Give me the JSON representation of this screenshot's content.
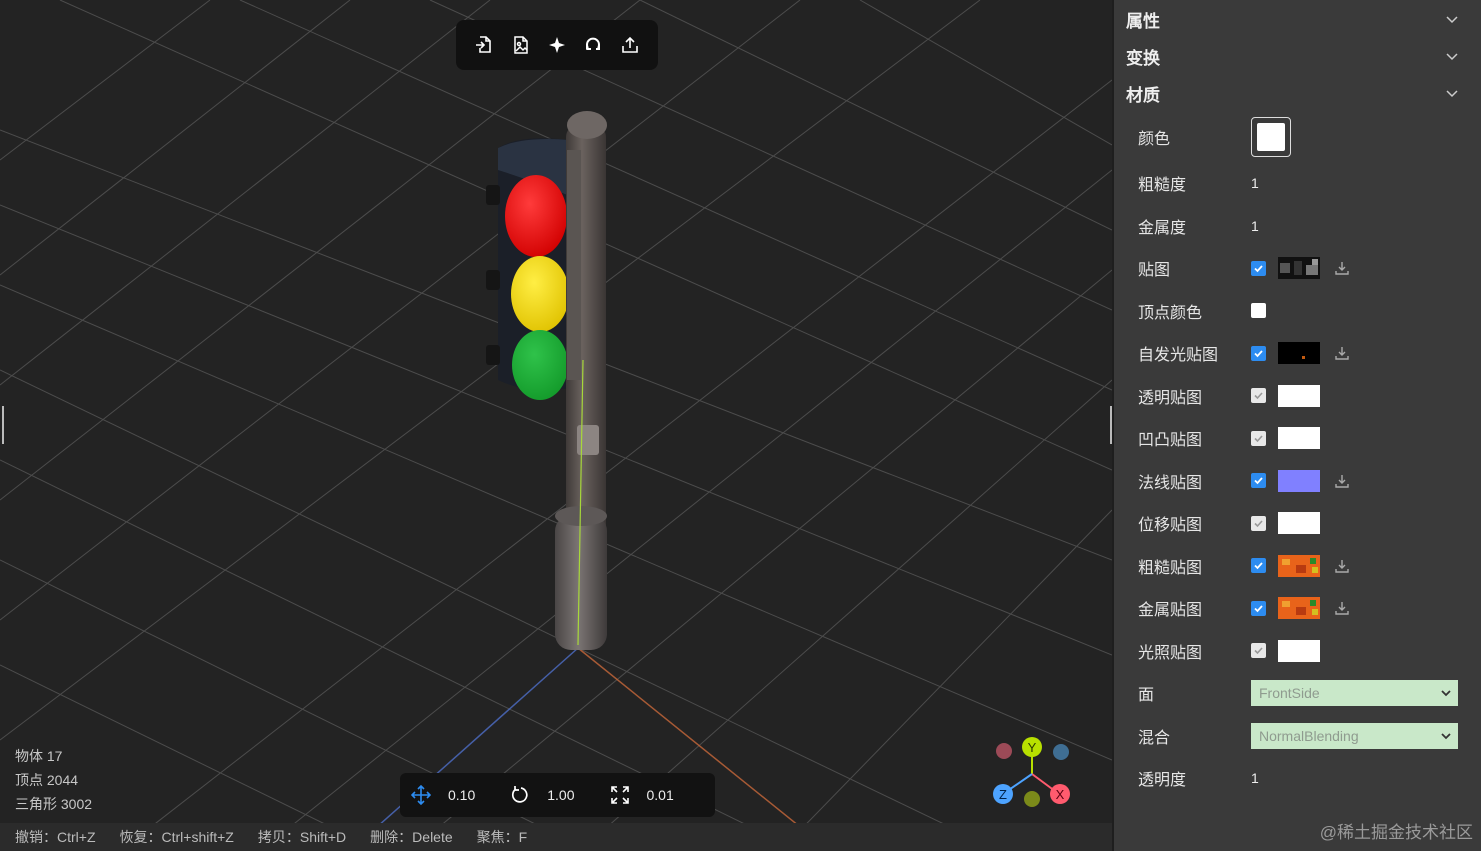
{
  "toolbar": {
    "buttons": [
      {
        "icon": "import-icon"
      },
      {
        "icon": "image-icon"
      },
      {
        "icon": "light-icon"
      },
      {
        "icon": "rotate-reset-icon"
      },
      {
        "icon": "export-icon"
      }
    ]
  },
  "stats": {
    "objects": "物体 17",
    "vertices": "顶点 2044",
    "triangles": "三角形 3002"
  },
  "transform_bar": {
    "translate_step": "0.10",
    "rotate_step": "1.00",
    "scale_step": "0.01"
  },
  "shortcuts": {
    "undo": "撤销：Ctrl+Z",
    "redo": "恢复：Ctrl+shift+Z",
    "copy": "拷贝：Shift+D",
    "delete": "删除：Delete",
    "focus": "聚焦：F"
  },
  "gizmo": {
    "x_label": "X",
    "y_label": "Y",
    "z_label": "Z"
  },
  "panel": {
    "sections": {
      "properties": "属性",
      "transform": "变换",
      "material": "材质"
    },
    "material": {
      "color_label": "颜色",
      "roughness_label": "粗糙度",
      "roughness_value": "1",
      "metalness_label": "金属度",
      "metalness_value": "1",
      "map_label": "贴图",
      "vertex_colors_label": "顶点颜色",
      "emissive_map_label": "自发光贴图",
      "alpha_map_label": "透明贴图",
      "bump_map_label": "凹凸贴图",
      "normal_map_label": "法线贴图",
      "displacement_map_label": "位移贴图",
      "roughness_map_label": "粗糙贴图",
      "metalness_map_label": "金属贴图",
      "light_map_label": "光照贴图",
      "side_label": "面",
      "side_value": "FrontSide",
      "blending_label": "混合",
      "blending_value": "NormalBlending",
      "opacity_label": "透明度",
      "opacity_value": "1"
    }
  },
  "watermark": "@稀土掘金技术社区",
  "colors": {
    "accent": "#2d8cf0",
    "panel_bg": "#3a3a3a",
    "select_bg": "#c9e8c9",
    "axis_x": "#ff5b6e",
    "axis_y": "#b8e000",
    "axis_z": "#4da3ff"
  }
}
